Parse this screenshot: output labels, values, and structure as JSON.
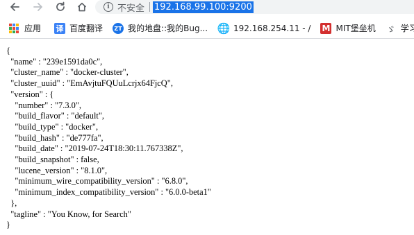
{
  "toolbar": {
    "insecure_label": "不安全",
    "url": "192.168.99.100:9200"
  },
  "bookmarks": [
    {
      "label": "应用",
      "icon": "apps-grid-icon"
    },
    {
      "label": "百度翻译",
      "icon": "translate-icon",
      "glyph": "译"
    },
    {
      "label": "我的地盘::我的Bug...",
      "icon": "zentao-icon",
      "glyph": "ZT"
    },
    {
      "label": "192.168.254.11 - /",
      "icon": "globe-icon",
      "glyph": "🌐"
    },
    {
      "label": "MIT堡垒机",
      "icon": "m-logo-icon",
      "glyph": "M"
    },
    {
      "label": "学习",
      "icon": "learn-icon",
      "glyph": "ゞ"
    }
  ],
  "json_lines": [
    "{",
    "  \"name\" : \"239e1591da0c\",",
    "  \"cluster_name\" : \"docker-cluster\",",
    "  \"cluster_uuid\" : \"EmAvjtuFQUuLcrjx64FjcQ\",",
    "  \"version\" : {",
    "    \"number\" : \"7.3.0\",",
    "    \"build_flavor\" : \"default\",",
    "    \"build_type\" : \"docker\",",
    "    \"build_hash\" : \"de777fa\",",
    "    \"build_date\" : \"2019-07-24T18:30:11.767338Z\",",
    "    \"build_snapshot\" : false,",
    "    \"lucene_version\" : \"8.1.0\",",
    "    \"minimum_wire_compatibility_version\" : \"6.8.0\",",
    "    \"minimum_index_compatibility_version\" : \"6.0.0-beta1\"",
    "  },",
    "  \"tagline\" : \"You Know, for Search\"",
    "}"
  ]
}
